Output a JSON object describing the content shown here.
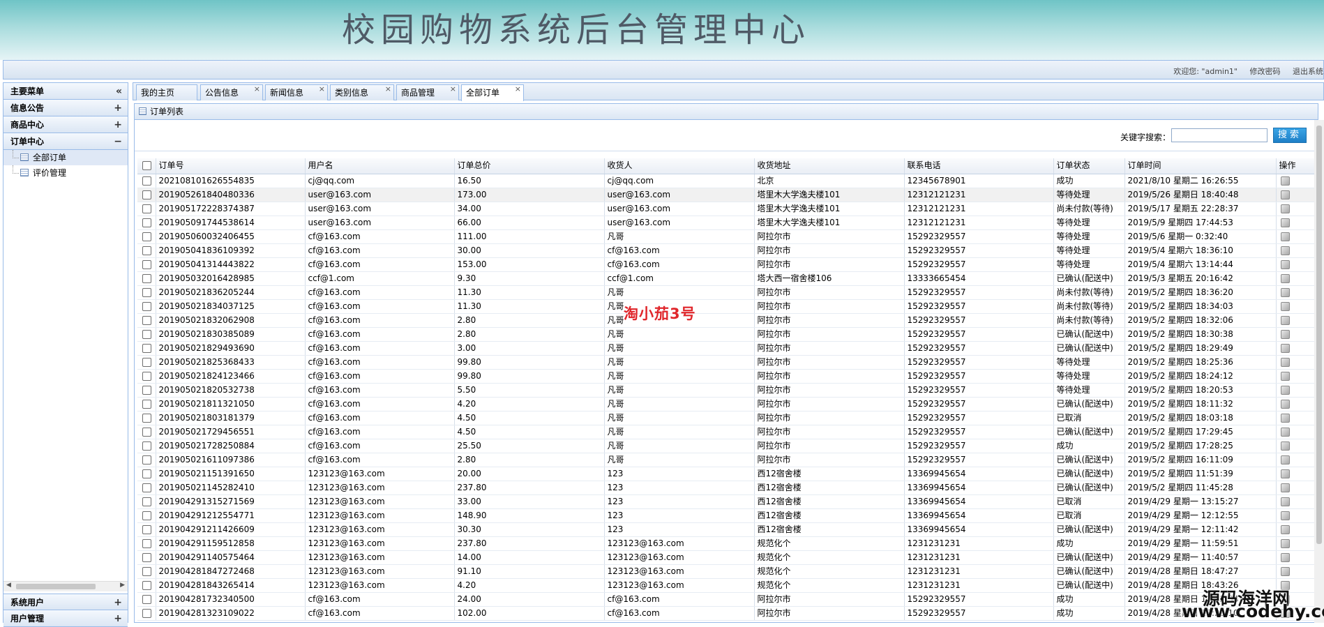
{
  "header": {
    "title": "校园购物系统后台管理中心"
  },
  "topbar": {
    "welcome": "欢迎您: \"admin1\"",
    "change_password": "修改密码",
    "logout": "退出系统"
  },
  "sidebar": {
    "title": "主要菜单",
    "collapse_icon": "«",
    "sections": [
      {
        "label": "信息公告",
        "toggle": "+"
      },
      {
        "label": "商品中心",
        "toggle": "+"
      },
      {
        "label": "订单中心",
        "toggle": "−"
      }
    ],
    "order_items": [
      {
        "label": "全部订单"
      },
      {
        "label": "评价管理"
      }
    ],
    "bottom_sections": [
      {
        "label": "系统用户",
        "toggle": "+"
      },
      {
        "label": "用户管理",
        "toggle": "+"
      }
    ]
  },
  "tabs": [
    {
      "label": "我的主页",
      "closable": false
    },
    {
      "label": "公告信息",
      "closable": true
    },
    {
      "label": "新闻信息",
      "closable": true
    },
    {
      "label": "类别信息",
      "closable": true
    },
    {
      "label": "商品管理",
      "closable": true
    },
    {
      "label": "全部订单",
      "closable": true,
      "active": true
    }
  ],
  "panel": {
    "title": "订单列表"
  },
  "search": {
    "label": "关键字搜索：",
    "placeholder": "",
    "button": "搜索"
  },
  "table": {
    "columns": [
      "订单号",
      "用户名",
      "订单总价",
      "收货人",
      "收货地址",
      "联系电话",
      "订单状态",
      "订单时间",
      "操作"
    ],
    "rows": [
      [
        "20210810162655483​5",
        "cj@qq.com",
        "16.50",
        "cj@qq.com",
        "北京",
        "12345678901",
        "成功",
        "2021/8/10 星期二 16:26:55"
      ],
      [
        "201905261840480336",
        "user@163.com",
        "173.00",
        "user@163.com",
        "塔里木大学逸夫楼101",
        "12312121231",
        "等待处理",
        "2019/5/26 星期日 18:40:48"
      ],
      [
        "201905172228374387",
        "user@163.com",
        "34.00",
        "user@163.com",
        "塔里木大学逸夫楼101",
        "12312121231",
        "尚未付款(等待)",
        "2019/5/17 星期五 22:28:37"
      ],
      [
        "201905091744538614",
        "user@163.com",
        "66.00",
        "user@163.com",
        "塔里木大学逸夫楼101",
        "12312121231",
        "等待处理",
        "2019/5/9 星期四 17:44:53"
      ],
      [
        "201905060032406455",
        "cf@163.com",
        "111.00",
        "凡哥",
        "阿拉尔市",
        "15292329557",
        "等待处理",
        "2019/5/6 星期一 0:32:40"
      ],
      [
        "201905041836109392",
        "cf@163.com",
        "30.00",
        "cf@163.com",
        "阿拉尔市",
        "15292329557",
        "等待处理",
        "2019/5/4 星期六 18:36:10"
      ],
      [
        "201905041314443822",
        "cf@163.com",
        "153.00",
        "cf@163.com",
        "阿拉尔市",
        "15292329557",
        "等待处理",
        "2019/5/4 星期六 13:14:44"
      ],
      [
        "201905032016428985",
        "ccf@1.com",
        "9.30",
        "ccf@1.com",
        "塔大西一宿舍楼106",
        "13333665454",
        "已确认(配送中)",
        "2019/5/3 星期五 20:16:42"
      ],
      [
        "201905021836205244",
        "cf@163.com",
        "11.30",
        "凡哥",
        "阿拉尔市",
        "15292329557",
        "尚未付款(等待)",
        "2019/5/2 星期四 18:36:20"
      ],
      [
        "201905021834037125",
        "cf@163.com",
        "11.30",
        "凡哥",
        "阿拉尔市",
        "15292329557",
        "尚未付款(等待)",
        "2019/5/2 星期四 18:34:03"
      ],
      [
        "201905021832062908",
        "cf@163.com",
        "2.80",
        "凡哥",
        "阿拉尔市",
        "15292329557",
        "尚未付款(等待)",
        "2019/5/2 星期四 18:32:06"
      ],
      [
        "201905021830385089",
        "cf@163.com",
        "2.80",
        "凡哥",
        "阿拉尔市",
        "15292329557",
        "已确认(配送中)",
        "2019/5/2 星期四 18:30:38"
      ],
      [
        "201905021829493690",
        "cf@163.com",
        "3.00",
        "凡哥",
        "阿拉尔市",
        "15292329557",
        "已确认(配送中)",
        "2019/5/2 星期四 18:29:49"
      ],
      [
        "201905021825368433",
        "cf@163.com",
        "99.80",
        "凡哥",
        "阿拉尔市",
        "15292329557",
        "等待处理",
        "2019/5/2 星期四 18:25:36"
      ],
      [
        "201905021824123466",
        "cf@163.com",
        "99.80",
        "凡哥",
        "阿拉尔市",
        "15292329557",
        "等待处理",
        "2019/5/2 星期四 18:24:12"
      ],
      [
        "201905021820532738",
        "cf@163.com",
        "5.50",
        "凡哥",
        "阿拉尔市",
        "15292329557",
        "等待处理",
        "2019/5/2 星期四 18:20:53"
      ],
      [
        "201905021811321050",
        "cf@163.com",
        "4.20",
        "凡哥",
        "阿拉尔市",
        "15292329557",
        "已确认(配送中)",
        "2019/5/2 星期四 18:11:32"
      ],
      [
        "201905021803181379",
        "cf@163.com",
        "4.50",
        "凡哥",
        "阿拉尔市",
        "15292329557",
        "已取消",
        "2019/5/2 星期四 18:03:18"
      ],
      [
        "201905021729456551",
        "cf@163.com",
        "4.50",
        "凡哥",
        "阿拉尔市",
        "15292329557",
        "已确认(配送中)",
        "2019/5/2 星期四 17:29:45"
      ],
      [
        "201905021728250884",
        "cf@163.com",
        "25.50",
        "凡哥",
        "阿拉尔市",
        "15292329557",
        "成功",
        "2019/5/2 星期四 17:28:25"
      ],
      [
        "201905021611097386",
        "cf@163.com",
        "2.80",
        "凡哥",
        "阿拉尔市",
        "15292329557",
        "已确认(配送中)",
        "2019/5/2 星期四 16:11:09"
      ],
      [
        "201905021151391650",
        "123123@163.com",
        "20.00",
        "123",
        "西12宿舍楼",
        "13369945654",
        "已确认(配送中)",
        "2019/5/2 星期四 11:51:39"
      ],
      [
        "201905021145282410",
        "123123@163.com",
        "237.80",
        "123",
        "西12宿舍楼",
        "13369945654",
        "已确认(配送中)",
        "2019/5/2 星期四 11:45:28"
      ],
      [
        "201904291315271569",
        "123123@163.com",
        "33.00",
        "123",
        "西12宿舍楼",
        "13369945654",
        "已取消",
        "2019/4/29 星期一 13:15:27"
      ],
      [
        "201904291212554771",
        "123123@163.com",
        "148.90",
        "123",
        "西12宿舍楼",
        "13369945654",
        "已取消",
        "2019/4/29 星期一 12:12:55"
      ],
      [
        "201904291211426609",
        "123123@163.com",
        "30.30",
        "123",
        "西12宿舍楼",
        "13369945654",
        "已确认(配送中)",
        "2019/4/29 星期一 12:11:42"
      ],
      [
        "201904291159512858",
        "123123@163.com",
        "237.80",
        "123123@163.com",
        "规范化个",
        "1231231231",
        "成功",
        "2019/4/29 星期一 11:59:51"
      ],
      [
        "201904291140575464",
        "123123@163.com",
        "14.00",
        "123123@163.com",
        "规范化个",
        "1231231231",
        "已确认(配送中)",
        "2019/4/29 星期一 11:40:57"
      ],
      [
        "201904281847272468",
        "123123@163.com",
        "91.10",
        "123123@163.com",
        "规范化个",
        "1231231231",
        "已确认(配送中)",
        "2019/4/28 星期日 18:47:27"
      ],
      [
        "201904281843265414",
        "123123@163.com",
        "4.20",
        "123123@163.com",
        "规范化个",
        "1231231231",
        "已确认(配送中)",
        "2019/4/28 星期日 18:43:26"
      ],
      [
        "201904281732340500",
        "cf@163.com",
        "24.00",
        "cf@163.com",
        "阿拉尔市",
        "15292329557",
        "成功",
        "2019/4/28 星期日 17:32:34"
      ],
      [
        "201904281323109022",
        "cf@163.com",
        "102.00",
        "cf@163.com",
        "阿拉尔市",
        "15292329557",
        "成功",
        "2019/4/28 星期日 13:23:10"
      ]
    ]
  },
  "overlay": {
    "text": "淘小茄3号"
  },
  "watermark": {
    "line1": "源码海洋网",
    "line2": "www.codehy.com"
  }
}
